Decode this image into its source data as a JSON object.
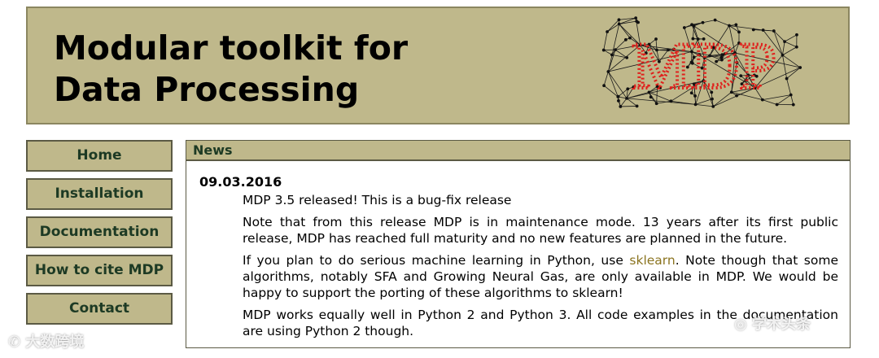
{
  "header": {
    "title_line1": "Modular toolkit for",
    "title_line2": "Data Processing",
    "logo_text": "MDP"
  },
  "nav": {
    "items": [
      {
        "label": "Home"
      },
      {
        "label": "Installation"
      },
      {
        "label": "Documentation"
      },
      {
        "label": "How to cite MDP"
      },
      {
        "label": "Contact"
      }
    ]
  },
  "news": {
    "heading": "News",
    "date": "09.03.2016",
    "p1": "MDP 3.5 released! This is a bug-fix release",
    "p2": "Note that from this release MDP is in maintenance mode. 13 years after its first public release, MDP has reached full maturity and no new features are planned in the future.",
    "p3_before": "If you plan to do serious machine learning in Python, use ",
    "p3_link": "sklearn",
    "p3_after": ". Note though that some algorithms, notably SFA and Growing Neural Gas, are only available in MDP. We would be happy to support the porting of these algorithms to sklearn!",
    "p4": "MDP works equally well in Python 2 and Python 3. All code examples in the documentation are using Python 2 though."
  },
  "watermarks": {
    "left": "大数跨境",
    "right": "学术头条"
  },
  "colors": {
    "header_bg": "#bfb88b",
    "nav_text": "#1d3a24",
    "link": "#8b7420",
    "logo_red": "#e0201c"
  }
}
